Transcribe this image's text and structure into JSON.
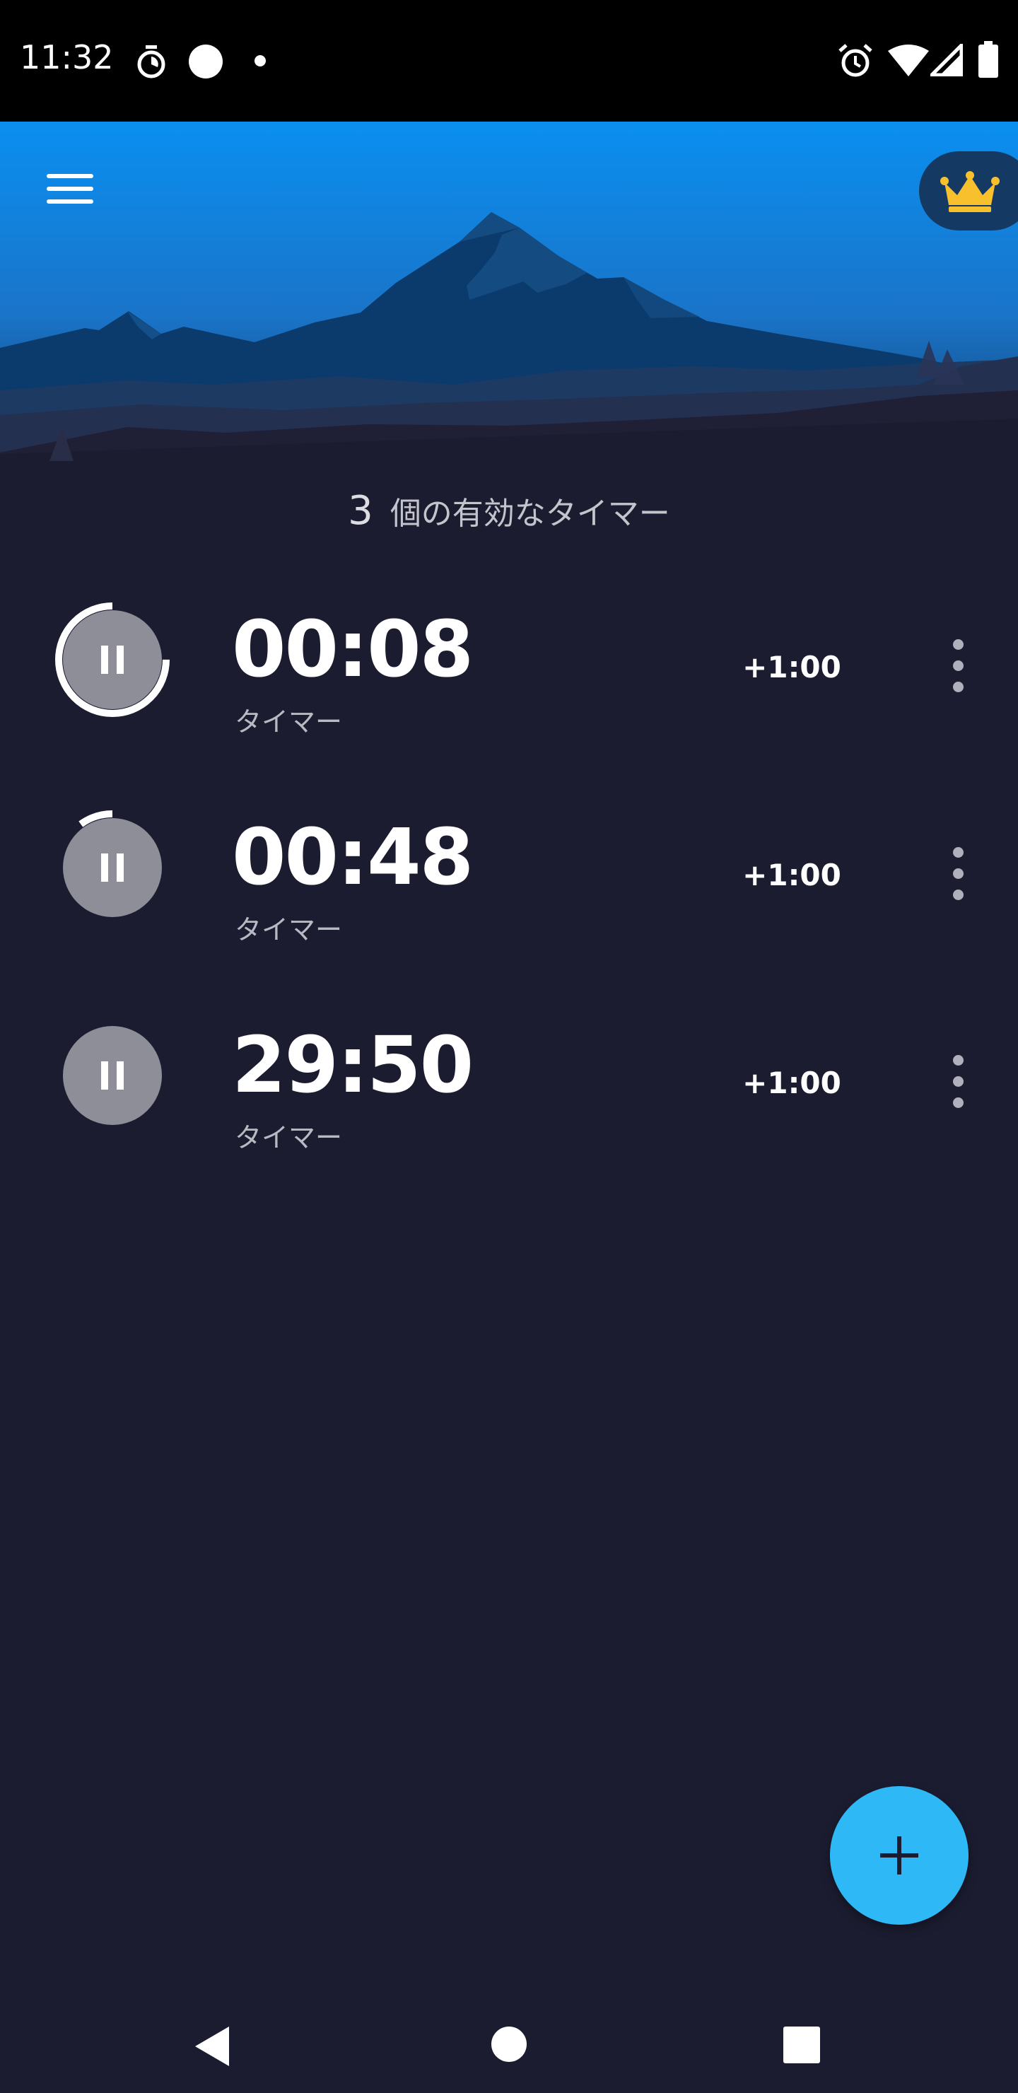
{
  "status_bar": {
    "time": "11:32",
    "icons": [
      "timer-icon",
      "circle-notification-icon",
      "dot-icon",
      "alarm-icon",
      "wifi-icon",
      "signal-icon",
      "battery-icon"
    ]
  },
  "header": {
    "menu_icon": "hamburger-menu-icon",
    "premium_icon": "crown-icon",
    "sky_color": "#0a8ff0",
    "crown_color": "#f7c02c"
  },
  "summary": {
    "count": "3",
    "label": "個の有効なタイマー"
  },
  "timers": [
    {
      "time": "00:08",
      "label": "タイマー",
      "add_label": "+1:00",
      "progress": 0.75
    },
    {
      "time": "00:48",
      "label": "タイマー",
      "add_label": "+1:00",
      "progress": 0.1
    },
    {
      "time": "29:50",
      "label": "タイマー",
      "add_label": "+1:00",
      "progress": 0.0
    }
  ],
  "fab": {
    "icon": "plus-icon",
    "color": "#2eb8f5"
  },
  "nav_bar": {
    "icons": [
      "back-icon",
      "home-icon",
      "recents-icon"
    ]
  },
  "colors": {
    "background": "#1c1c31",
    "accent": "#2eb8f5",
    "pause_circle": "#8e8e98"
  }
}
